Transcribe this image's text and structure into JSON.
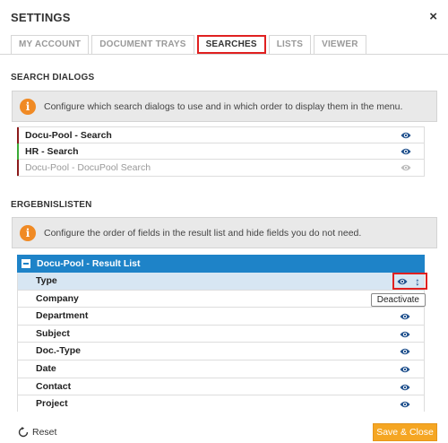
{
  "header": {
    "title": "SETTINGS",
    "close_label": "×"
  },
  "tabs": [
    {
      "label": "MY ACCOUNT",
      "active": false
    },
    {
      "label": "DOCUMENT TRAYS",
      "active": false
    },
    {
      "label": "SEARCHES",
      "active": true
    },
    {
      "label": "LISTS",
      "active": false
    },
    {
      "label": "VIEWER",
      "active": false
    }
  ],
  "search_dialogs": {
    "title": "SEARCH DIALOGS",
    "info": "Configure which search dialogs to use and in which order to display them in the menu.",
    "items": [
      {
        "label": "Docu-Pool - Search",
        "bar_color": "#8b1a1a",
        "active": true
      },
      {
        "label": "HR  - Search",
        "bar_color": "#3aaa35",
        "active": true
      },
      {
        "label": "Docu-Pool - DocuPool Search",
        "bar_color": "#8b1a1a",
        "active": false
      }
    ]
  },
  "result_lists": {
    "title": "ERGEBNISLISTEN",
    "info": "Configure the order of fields in the result list and hide fields you do not need.",
    "list_title": "Docu-Pool - Result List",
    "fields": [
      {
        "label": "Type"
      },
      {
        "label": "Company"
      },
      {
        "label": "Department"
      },
      {
        "label": "Subject"
      },
      {
        "label": "Doc.-Type"
      },
      {
        "label": "Date"
      },
      {
        "label": "Contact"
      },
      {
        "label": "Project"
      }
    ],
    "tooltip": "Deactivate",
    "move_glyph": "↕"
  },
  "footer": {
    "reset_label": "Reset",
    "save_label": "Save & Close"
  },
  "colors": {
    "accent": "#1e83c8",
    "info_icon": "#f08a24",
    "save_button": "#f5a623",
    "highlight_border": "#e02020"
  }
}
